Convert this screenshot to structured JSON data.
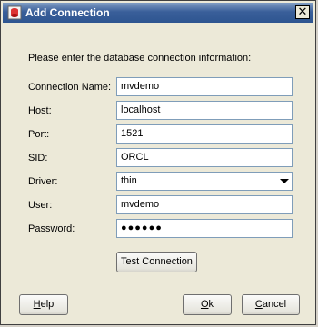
{
  "window": {
    "title": "Add Connection",
    "close_glyph": "✕"
  },
  "intro": "Please enter the database connection information:",
  "form": {
    "connection_name": {
      "label": "Connection Name:",
      "value": "mvdemo"
    },
    "host": {
      "label": "Host:",
      "value": "localhost"
    },
    "port": {
      "label": "Port:",
      "value": "1521"
    },
    "sid": {
      "label": "SID:",
      "value": "ORCL"
    },
    "driver": {
      "label": "Driver:",
      "value": "thin"
    },
    "user": {
      "label": "User:",
      "value": "mvdemo"
    },
    "password": {
      "label": "Password:",
      "value": "●●●●●●"
    }
  },
  "buttons": {
    "test_connection": "Test Connection",
    "help": {
      "first": "H",
      "rest": "elp"
    },
    "ok": {
      "first": "O",
      "rest": "k"
    },
    "cancel": {
      "first": "C",
      "rest": "ancel"
    }
  },
  "icons": {
    "title": "database-icon",
    "dropdown": "triangle-down-icon",
    "close": "close-icon"
  }
}
